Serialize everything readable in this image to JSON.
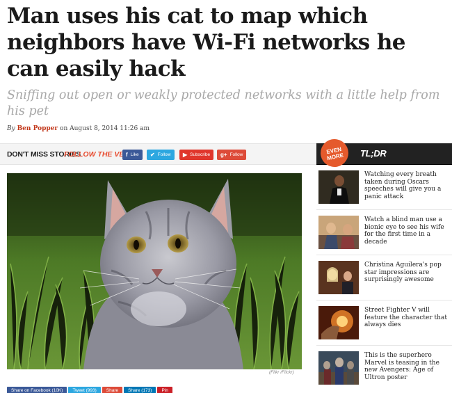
{
  "article": {
    "headline": "Man uses his cat to map which neighbors have Wi-Fi networks he can easily hack",
    "dek": "Sniffing out open or weakly protected networks with a little help from his pet",
    "byline_prefix": "By",
    "author": "Ben Popper",
    "date_text": "on August 8, 2014 11:26 am",
    "image_credit": "(Flikr /Flickr)"
  },
  "follow_bar": {
    "dont_miss": "DON'T MISS STORIES",
    "follow_verge": "FOLLOW THE VERGE",
    "buttons": [
      {
        "icon": "f",
        "label": "Like",
        "color": "#3b5998",
        "icon_name": "facebook-icon"
      },
      {
        "icon": "✔",
        "label": "Follow",
        "color": "#2ca7e0",
        "icon_name": "twitter-icon"
      },
      {
        "icon": "▶",
        "label": "Subscribe",
        "color": "#e0362c",
        "icon_name": "youtube-icon"
      },
      {
        "icon": "g+",
        "label": "Follow",
        "color": "#dd4b39",
        "icon_name": "google-plus-icon"
      }
    ]
  },
  "sidebar": {
    "badge": "EVEN MORE",
    "title": "TL;DR",
    "items": [
      {
        "text": "Watching every breath taken during Oscars speeches will give you a panic attack"
      },
      {
        "text": "Watch a blind man use a bionic eye to see his wife for the first time in a decade"
      },
      {
        "text": "Christina Aguilera's pop star impressions are surprisingly awesome"
      },
      {
        "text": "Street Fighter V will feature the character that always dies"
      },
      {
        "text": "This is the superhero Marvel is teasing in the new Avengers: Age of Ultron poster"
      }
    ]
  },
  "share_row": [
    {
      "label": "Share on Facebook (10K)",
      "color": "#3b5998"
    },
    {
      "label": "Tweet (993)",
      "color": "#2ca7e0"
    },
    {
      "label": "Share",
      "color": "#dd4b39"
    },
    {
      "label": "Share (173)",
      "color": "#0077b5"
    },
    {
      "label": "Pin",
      "color": "#cb2027"
    }
  ]
}
